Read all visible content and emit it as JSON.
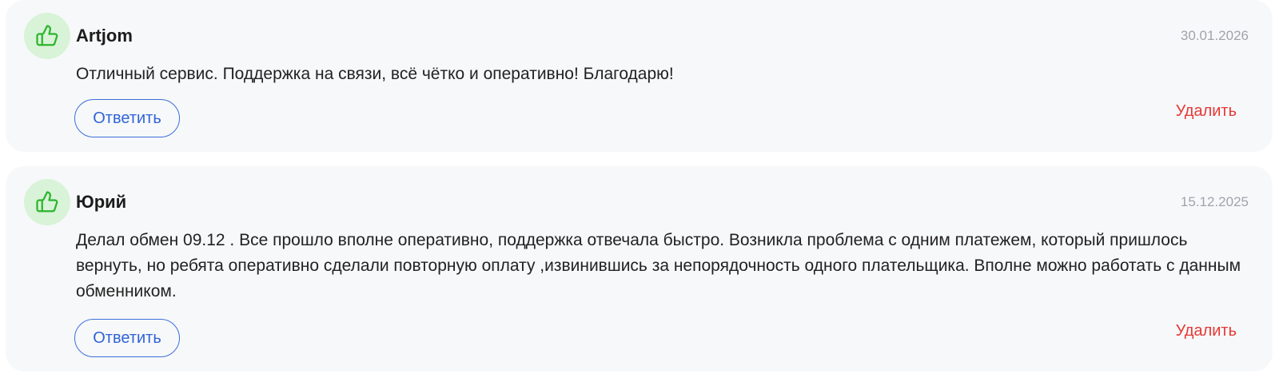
{
  "reviews": [
    {
      "icon": "thumbs-up-icon",
      "author": "Artjom",
      "date": "30.01.2026",
      "text": "Отличный сервис. Поддержка на связи, всё чётко и оперативно! Благодарю!",
      "reply_label": "Ответить",
      "delete_label": "Удалить"
    },
    {
      "icon": "thumbs-up-icon",
      "author": "Юрий",
      "date": "15.12.2025",
      "text": "Делал обмен 09.12 . Все прошло вполне оперативно, поддержка отвечала быстро. Возникла проблема с одним платежем, который пришлось вернуть, но ребята оперативно сделали повторную оплату ,извинившись за непорядочность одного плательщика. Вполне можно работать с данным обменником.",
      "reply_label": "Ответить",
      "delete_label": "Удалить"
    }
  ],
  "colors": {
    "card_background": "#f7f8fa",
    "avatar_background": "#d8f3d8",
    "icon_green": "#2bb52b",
    "reply_blue": "#2f63d6",
    "delete_red": "#e53935",
    "date_gray": "#a0a4aa"
  }
}
